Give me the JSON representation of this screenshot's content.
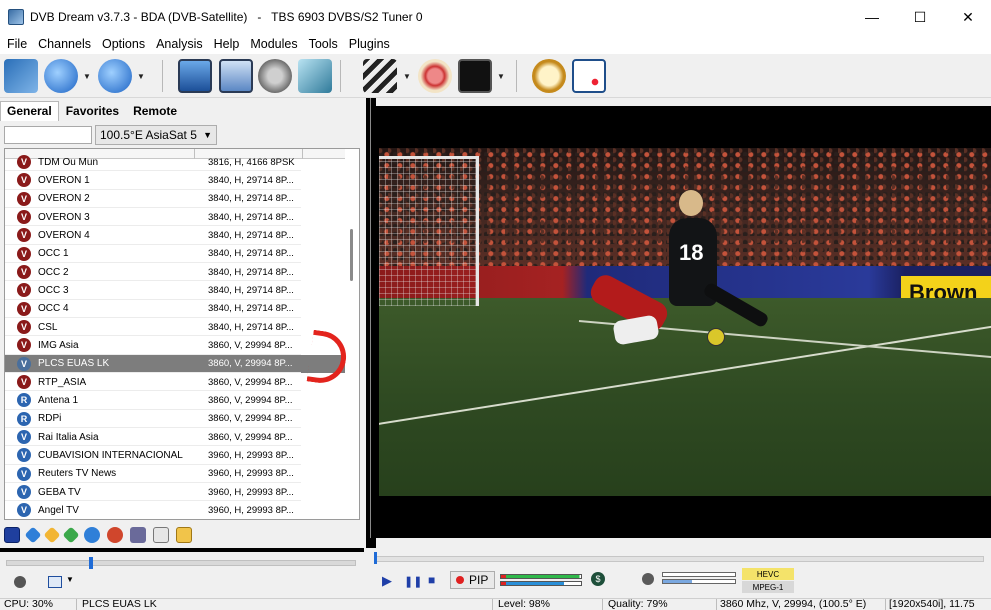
{
  "window": {
    "title": "DVB Dream v3.7.3 - BDA (DVB-Satellite)   -   TBS 6903 DVBS/S2 Tuner 0",
    "minimize_glyph": "—",
    "maximize_glyph": "☐",
    "close_glyph": "✕"
  },
  "menu": [
    "File",
    "Channels",
    "Options",
    "Analysis",
    "Help",
    "Modules",
    "Tools",
    "Plugins"
  ],
  "left_panel": {
    "tabs": [
      "General",
      "Favorites",
      "Remote"
    ],
    "active_tab": "General",
    "satellite": "100.5°E AsiaSat 5",
    "channels": [
      {
        "icon": "V",
        "name": "TDM Ou Mun",
        "tp": "3816, H, 4166 8PSK"
      },
      {
        "icon": "V",
        "name": "OVERON 1",
        "tp": "3840, H, 29714 8P..."
      },
      {
        "icon": "V",
        "name": "OVERON 2",
        "tp": "3840, H, 29714 8P..."
      },
      {
        "icon": "V",
        "name": "OVERON 3",
        "tp": "3840, H, 29714 8P..."
      },
      {
        "icon": "V",
        "name": "OVERON 4",
        "tp": "3840, H, 29714 8P..."
      },
      {
        "icon": "V",
        "name": "OCC 1",
        "tp": "3840, H, 29714 8P..."
      },
      {
        "icon": "V",
        "name": "OCC 2",
        "tp": "3840, H, 29714 8P..."
      },
      {
        "icon": "V",
        "name": "OCC 3",
        "tp": "3840, H, 29714 8P..."
      },
      {
        "icon": "V",
        "name": "OCC 4",
        "tp": "3840, H, 29714 8P..."
      },
      {
        "icon": "V",
        "name": "CSL",
        "tp": "3840, H, 29714 8P..."
      },
      {
        "icon": "V",
        "name": "IMG Asia",
        "tp": "3860, V, 29994 8P..."
      },
      {
        "icon": "V",
        "name": "PLCS EUAS LK",
        "tp": "3860, V, 29994 8P...",
        "selected": true
      },
      {
        "icon": "V",
        "name": "RTP_ASIA",
        "tp": "3860, V, 29994 8P..."
      },
      {
        "icon": "R",
        "name": "Antena 1",
        "tp": "3860, V, 29994 8P..."
      },
      {
        "icon": "R",
        "name": "RDPi",
        "tp": "3860, V, 29994 8P..."
      },
      {
        "icon": "V",
        "name": "Rai Italia Asia",
        "tp": "3860, V, 29994 8P..."
      },
      {
        "icon": "V",
        "name": "CUBAVISION INTERNACIONAL",
        "tp": "3960, H, 29993 8P..."
      },
      {
        "icon": "V",
        "name": "Reuters TV News",
        "tp": "3960, H, 29993 8P..."
      },
      {
        "icon": "V",
        "name": "GEBA TV",
        "tp": "3960, H, 29993 8P..."
      },
      {
        "icon": "V",
        "name": "Angel TV",
        "tp": "3960, H, 29993 8P..."
      }
    ]
  },
  "video": {
    "board_text": "Brown",
    "player_number": "18"
  },
  "controls": {
    "play": "▶",
    "pause": "❚❚",
    "stop": "■",
    "pip_label": "PIP",
    "codec_top": "HEVC",
    "codec_bottom": "MPEG-1",
    "round_glyph": "$"
  },
  "status": {
    "cpu": "CPU: 30%",
    "channel": "PLCS EUAS LK",
    "level": "Level: 98%",
    "quality": "Quality: 79%",
    "tp": "3860 Mhz, V, 29994, (100.5° E)",
    "res": "[1920x540i], 11.75"
  },
  "colors": {
    "selection": "#7d7d7d",
    "level_bar": "#22c55e",
    "annotation": "#e3241d"
  }
}
